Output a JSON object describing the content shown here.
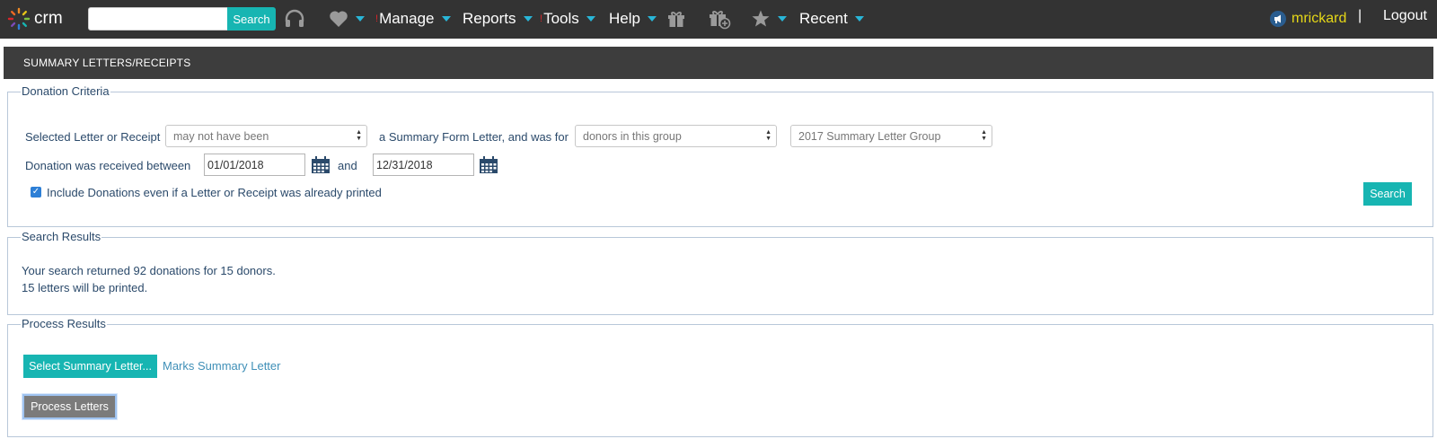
{
  "nav": {
    "logo_text": "crm",
    "search_placeholder": "",
    "search_button": "Search",
    "items": {
      "manage": "Manage",
      "reports": "Reports",
      "tools": "Tools",
      "help": "Help",
      "recent": "Recent"
    },
    "alert_mark": "!",
    "user": "mrickard",
    "separator": "|",
    "logout": "Logout"
  },
  "page": {
    "title": "SUMMARY LETTERS/RECEIPTS"
  },
  "criteria": {
    "legend": "Donation Criteria",
    "selected_label": "Selected Letter or Receipt",
    "selected_value": "may not have been",
    "middle_label": "a Summary Form Letter, and was for",
    "for_value": "donors in this group",
    "group_value": "2017 Summary Letter Group",
    "received_label": "Donation was received between",
    "date_from": "01/01/2018",
    "and_label": "and",
    "date_to": "12/31/2018",
    "include_label": "Include Donations even if a Letter or Receipt was already printed",
    "include_checked": true,
    "search_button": "Search"
  },
  "results": {
    "legend": "Search Results",
    "line1": "Your search returned 92 donations for 15 donors.",
    "line2": "15 letters will be printed."
  },
  "process": {
    "legend": "Process Results",
    "select_button": "Select Summary Letter...",
    "letter_link": "Marks Summary Letter",
    "process_button": "Process Letters"
  },
  "colors": {
    "topbar": "#333333",
    "accent_teal": "#17b5b2",
    "caret_blue": "#29b6d8",
    "username_yellow": "#e6d817",
    "alert_red": "#d9252a"
  }
}
